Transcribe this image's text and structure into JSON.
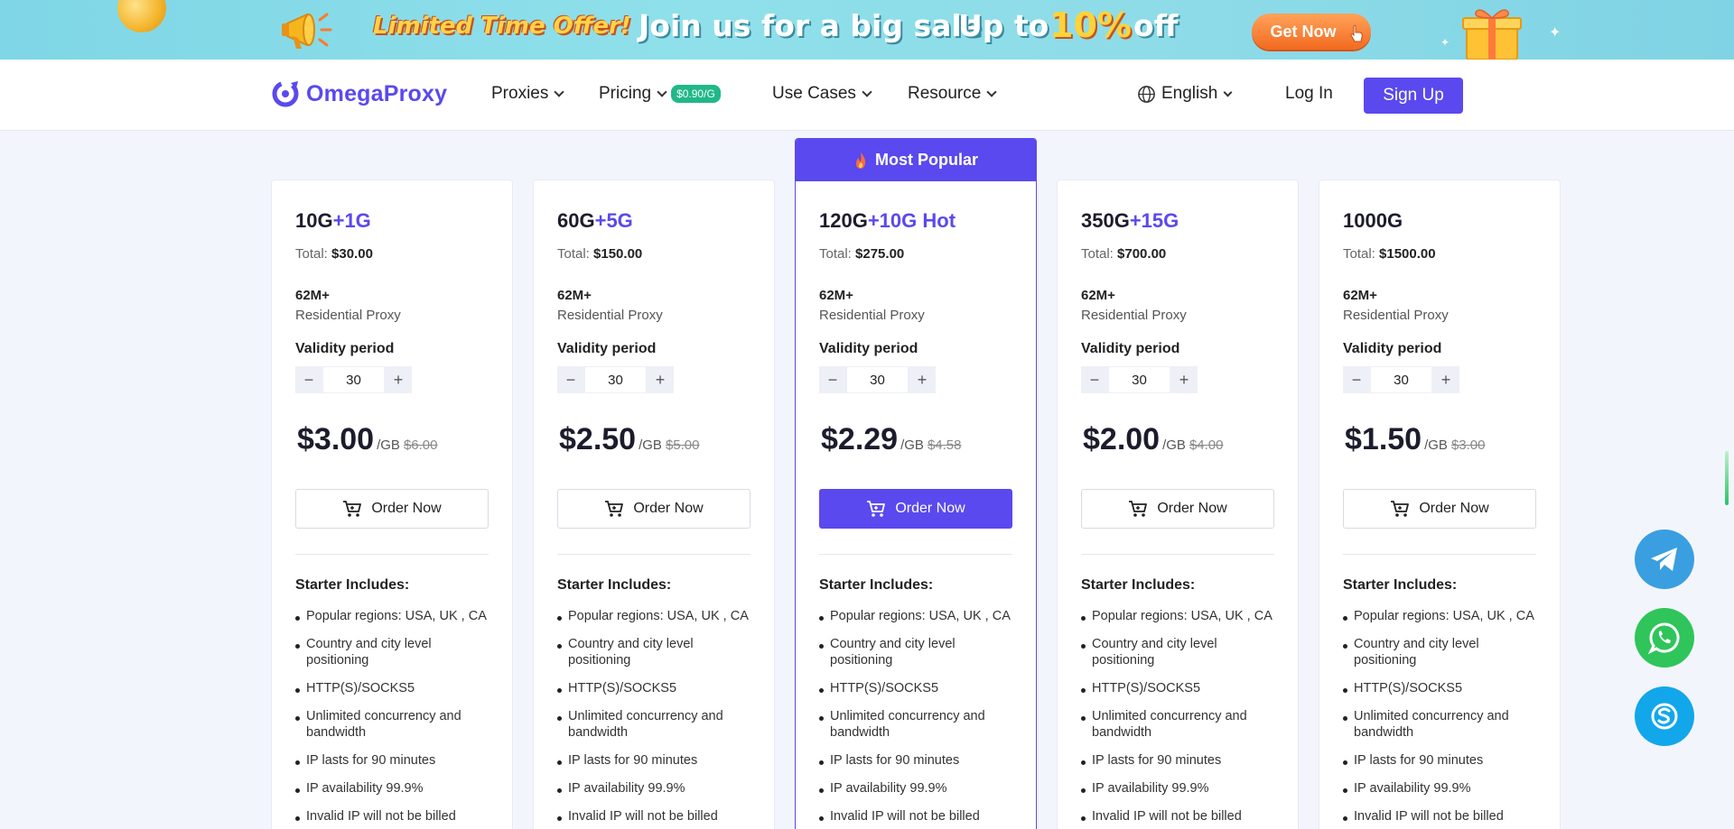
{
  "promo": {
    "offer": "Limited Time Offer!",
    "join": "Join us for a big sale",
    "upto": "Up to",
    "percent": "10%",
    "off": "off",
    "cta": "Get Now"
  },
  "nav": {
    "brand": "OmegaProxy",
    "items": [
      {
        "label": "Proxies"
      },
      {
        "label": "Pricing",
        "badge": "$0.90/G"
      },
      {
        "label": "Use Cases"
      },
      {
        "label": "Resource"
      }
    ],
    "language": "English",
    "login": "Log In",
    "signup": "Sign Up"
  },
  "popular_label": "Most Popular",
  "common": {
    "total_label": "Total:",
    "ips": "62M+",
    "proxy_type": "Residential Proxy",
    "validity_label": "Validity period",
    "minus": "−",
    "plus": "+",
    "unit": "/GB",
    "order": "Order Now",
    "includes": "Starter Includes:",
    "features": [
      "Popular regions: USA, UK , CA",
      "Country and city level positioning",
      "HTTP(S)/SOCKS5",
      "Unlimited concurrency and bandwidth",
      "IP lasts for 90 minutes",
      "IP availability 99.9%",
      "Invalid IP will not be billed"
    ]
  },
  "plans": [
    {
      "base": "10G",
      "bonus": "+1G",
      "total": "$30.00",
      "validity": "30",
      "price": "$3.00",
      "old_price": "$6.00",
      "popular": false
    },
    {
      "base": "60G",
      "bonus": "+5G",
      "total": "$150.00",
      "validity": "30",
      "price": "$2.50",
      "old_price": "$5.00",
      "popular": false
    },
    {
      "base": "120G",
      "bonus": "+10G Hot",
      "total": "$275.00",
      "validity": "30",
      "price": "$2.29",
      "old_price": "$4.58",
      "popular": true
    },
    {
      "base": "350G",
      "bonus": "+15G",
      "total": "$700.00",
      "validity": "30",
      "price": "$2.00",
      "old_price": "$4.00",
      "popular": false
    },
    {
      "base": "1000G",
      "bonus": "",
      "total": "$1500.00",
      "validity": "30",
      "price": "$1.50",
      "old_price": "$3.00",
      "popular": false
    }
  ],
  "colors": {
    "accent": "#5a49ee",
    "badge": "#20b888",
    "telegram": "#3a9fe0",
    "whatsapp": "#2fc55a",
    "skype": "#12a7ea"
  },
  "floating": [
    "telegram-icon",
    "whatsapp-icon",
    "skype-icon"
  ]
}
